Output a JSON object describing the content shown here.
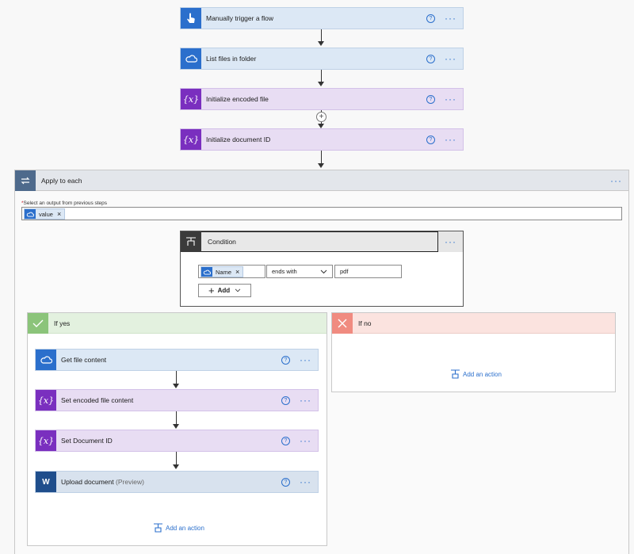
{
  "flow": {
    "trigger_title": "Manually trigger a flow",
    "list_files_title": "List files in folder",
    "init_encoded_title": "Initialize encoded file",
    "init_docid_title": "Initialize document ID",
    "help_glyph": "?",
    "more_glyph": "···",
    "plus_glyph": "+"
  },
  "apply_each": {
    "title": "Apply to each",
    "required_mark": "*",
    "field_label": "Select an output from previous steps",
    "token": "value",
    "remove_glyph": "×"
  },
  "condition": {
    "title": "Condition",
    "operand_token": "Name",
    "operator": "ends with",
    "value": "pdf",
    "add_label": "Add",
    "remove_glyph": "×"
  },
  "if_yes": {
    "title": "If yes",
    "actions": [
      {
        "title": "Get file content"
      },
      {
        "title": "Set encoded file content"
      },
      {
        "title": "Set Document ID"
      },
      {
        "title": "Upload document",
        "suffix": "(Preview)"
      }
    ],
    "add_action_label": "Add an action"
  },
  "if_no": {
    "title": "If no",
    "add_action_label": "Add an action"
  },
  "colors": {
    "accent": "#2b6fcc",
    "purple": "#7a2fbf",
    "yes_green": "#8bc47a",
    "no_red": "#f08b80"
  }
}
